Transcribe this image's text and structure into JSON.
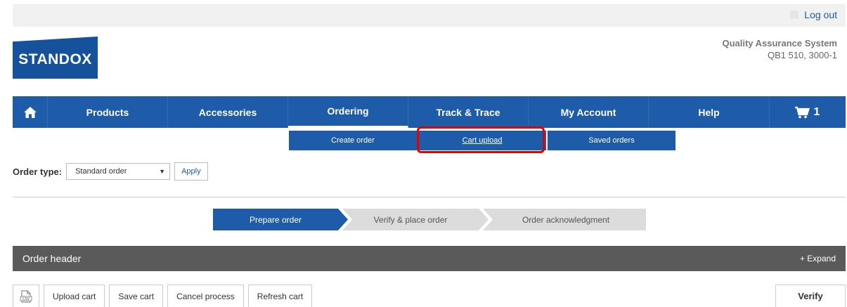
{
  "header": {
    "logout_label": "Log out",
    "logo_text": "STANDOX",
    "system_name": "Quality Assurance System",
    "system_code": "QB1 510, 3000-1"
  },
  "nav": {
    "items": [
      {
        "label": "Products"
      },
      {
        "label": "Accessories"
      },
      {
        "label": "Ordering",
        "active": true
      },
      {
        "label": "Track & Trace"
      },
      {
        "label": "My Account"
      },
      {
        "label": "Help"
      }
    ],
    "cart_count": "1"
  },
  "subnav": {
    "items": [
      {
        "label": "Create order"
      },
      {
        "label": "Cart upload",
        "highlighted": true
      },
      {
        "label": "Saved orders"
      }
    ]
  },
  "order_type": {
    "label": "Order type:",
    "selected": "Standard order",
    "apply_label": "Apply"
  },
  "steps": [
    {
      "label": "Prepare order",
      "active": true
    },
    {
      "label": "Verify & place order"
    },
    {
      "label": "Order acknowledgment"
    }
  ],
  "order_header": {
    "title": "Order header",
    "expand_label": "+ Expand"
  },
  "toolbar": {
    "upload_label": "Upload cart",
    "save_label": "Save cart",
    "cancel_label": "Cancel process",
    "refresh_label": "Refresh cart",
    "verify_label": "Verify"
  },
  "colors": {
    "nav_blue": "#1e5ba8",
    "highlight_red": "#e40000",
    "header_gray": "#5a5a5a"
  }
}
